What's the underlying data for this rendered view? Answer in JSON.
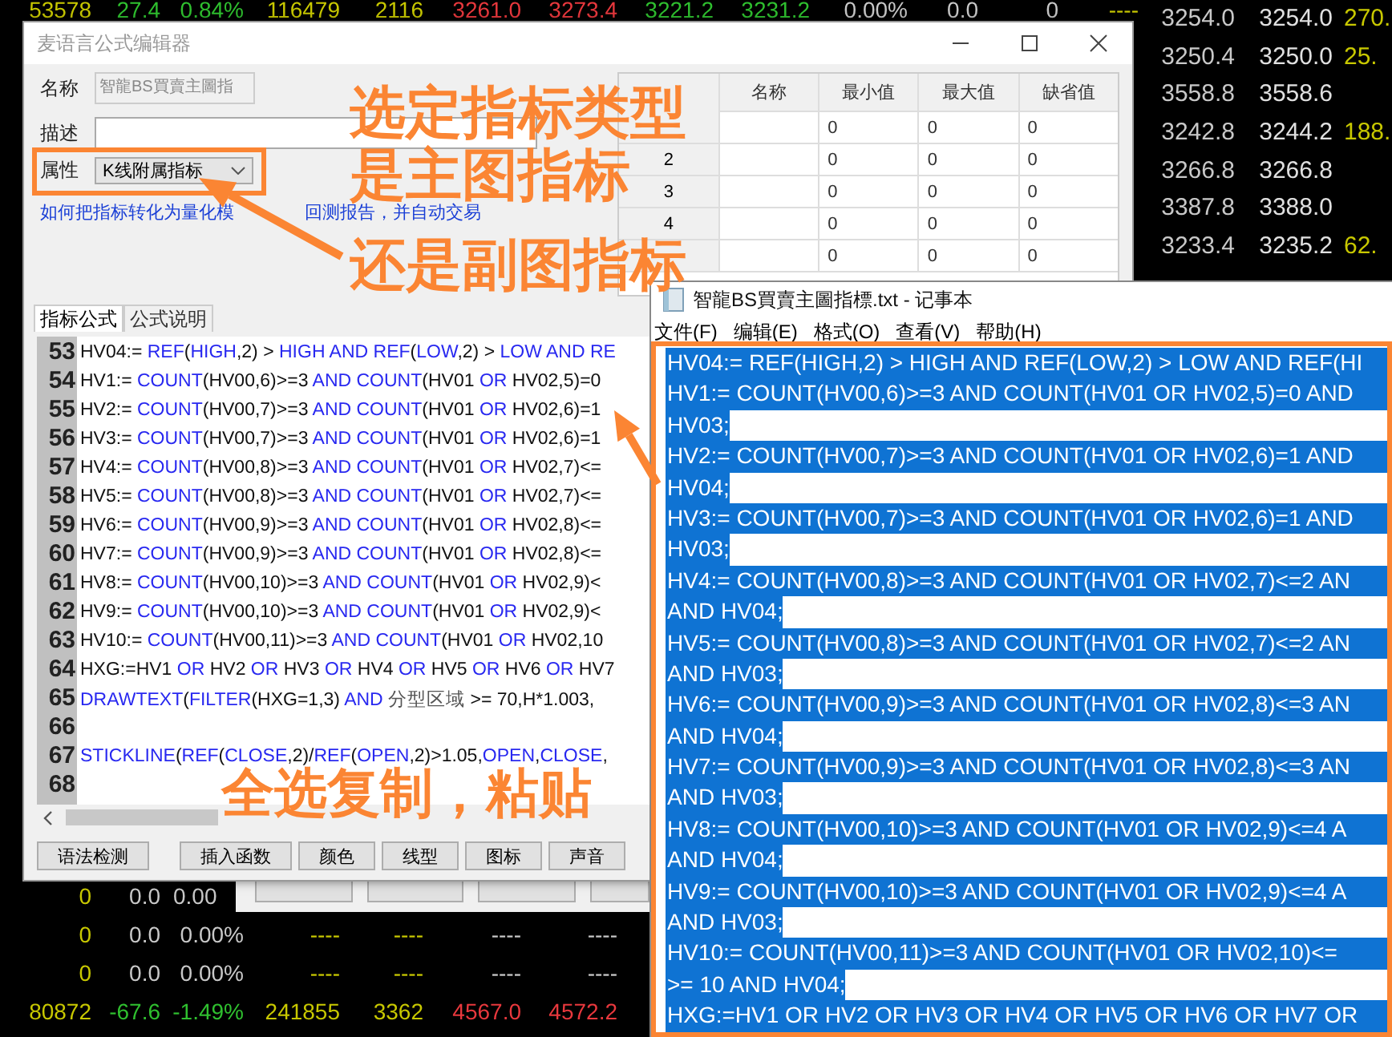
{
  "market": {
    "top_row": [
      {
        "text": "53578",
        "color": "#c8c800"
      },
      {
        "text": "27.4",
        "color": "#2fc02f"
      },
      {
        "text": "0.84%",
        "color": "#2fc02f"
      },
      {
        "text": "116479",
        "color": "#c8c800"
      },
      {
        "text": "2116",
        "color": "#c8c800"
      },
      {
        "text": "3261.0",
        "color": "#e8383d"
      },
      {
        "text": "3273.4",
        "color": "#e8383d"
      },
      {
        "text": "3221.2",
        "color": "#2fc02f"
      },
      {
        "text": "3231.2",
        "color": "#2fc02f"
      },
      {
        "text": "0.00%",
        "color": "#c8c8c8"
      },
      {
        "text": "0.0",
        "color": "#c8c8c8"
      },
      {
        "text": "0",
        "color": "#c8c8c8"
      },
      {
        "text": "----",
        "color": "#c8c800"
      }
    ],
    "right_rows": [
      [
        {
          "text": "3254.0",
          "color": "#c8c8c8"
        },
        {
          "text": "3254.0",
          "color": "#e0e0e0"
        },
        {
          "text": "270.",
          "color": "#c8c800"
        }
      ],
      [
        {
          "text": "3250.4",
          "color": "#c8c8c8"
        },
        {
          "text": "3250.0",
          "color": "#e0e0e0"
        },
        {
          "text": "25.",
          "color": "#c8c800"
        }
      ],
      [
        {
          "text": "3558.8",
          "color": "#c8c8c8"
        },
        {
          "text": "3558.6",
          "color": "#e0e0e0"
        }
      ],
      [
        {
          "text": "3242.8",
          "color": "#c8c8c8"
        },
        {
          "text": "3244.2",
          "color": "#e0e0e0"
        },
        {
          "text": "188.",
          "color": "#c8c800"
        }
      ],
      [
        {
          "text": "3266.8",
          "color": "#c8c8c8"
        },
        {
          "text": "3266.8",
          "color": "#e0e0e0"
        }
      ],
      [
        {
          "text": "3387.8",
          "color": "#c8c8c8"
        },
        {
          "text": "3388.0",
          "color": "#e0e0e0"
        }
      ],
      [
        {
          "text": "3233.4",
          "color": "#c8c8c8"
        },
        {
          "text": "3235.2",
          "color": "#e0e0e0"
        },
        {
          "text": "62.",
          "color": "#c8c800"
        }
      ]
    ],
    "bottom_rows": [
      [
        {
          "text": "0",
          "color": "#c8c800"
        },
        {
          "text": "0.0",
          "color": "#c8c8c8"
        },
        {
          "text": "0.00",
          "color": "#c8c8c8"
        }
      ],
      [
        {
          "text": "0",
          "color": "#c8c800"
        },
        {
          "text": "0.0",
          "color": "#c8c8c8"
        },
        {
          "text": "0.00%",
          "color": "#c8c8c8"
        },
        {
          "text": "----",
          "color": "#c8c800"
        },
        {
          "text": "----",
          "color": "#c8c800"
        },
        {
          "text": "----",
          "color": "#c8c8c8"
        },
        {
          "text": "----",
          "color": "#c8c8c8"
        }
      ],
      [
        {
          "text": "0",
          "color": "#c8c800"
        },
        {
          "text": "0.0",
          "color": "#c8c8c8"
        },
        {
          "text": "0.00%",
          "color": "#c8c8c8"
        },
        {
          "text": "----",
          "color": "#c8c800"
        },
        {
          "text": "----",
          "color": "#c8c800"
        },
        {
          "text": "----",
          "color": "#c8c8c8"
        },
        {
          "text": "----",
          "color": "#c8c8c8"
        }
      ],
      [
        {
          "text": "80872",
          "color": "#c8c800"
        },
        {
          "text": "-67.6",
          "color": "#2fc02f"
        },
        {
          "text": "-1.49%",
          "color": "#2fc02f"
        },
        {
          "text": "241855",
          "color": "#c8c800"
        },
        {
          "text": "3362",
          "color": "#c8c800"
        },
        {
          "text": "4567.0",
          "color": "#e8383d"
        },
        {
          "text": "4572.2",
          "color": "#e8383d"
        }
      ]
    ]
  },
  "editor": {
    "title": "麦语言公式编辑器",
    "name_field": {
      "label": "名称",
      "value": "智龍BS買賣主圖指",
      "disabled": true
    },
    "description_field": {
      "label": "描述"
    },
    "type_field": {
      "label": "属性",
      "value": "K线附属指标"
    },
    "help_link_parts": [
      "如何把指标转化为量化模",
      "回测报告，并自动交易"
    ],
    "params": {
      "columns": [
        "名称",
        "最小值",
        "最大值",
        "缺省值"
      ],
      "rows": [
        {
          "min": "0",
          "max": "0",
          "default": "0"
        },
        {
          "index": "2",
          "min": "0",
          "max": "0",
          "default": "0"
        },
        {
          "index": "3",
          "min": "0",
          "max": "0",
          "default": "0"
        },
        {
          "index": "4",
          "min": "0",
          "max": "0",
          "default": "0"
        },
        {
          "min": "0",
          "max": "0",
          "default": "0"
        }
      ]
    },
    "tabs": [
      {
        "label": "指标公式",
        "selected": true
      },
      {
        "label": "公式说明",
        "selected": false
      }
    ],
    "code_lines": [
      {
        "number": "53",
        "tokens": [
          {
            "kind": "plain",
            "text": "HV04:= "
          },
          {
            "kind": "keyword",
            "text": "REF"
          },
          {
            "kind": "plain",
            "text": "("
          },
          {
            "kind": "keyword",
            "text": "HIGH"
          },
          {
            "kind": "plain",
            "text": ",2) > "
          },
          {
            "kind": "keyword",
            "text": "HIGH AND REF"
          },
          {
            "kind": "plain",
            "text": "("
          },
          {
            "kind": "keyword",
            "text": "LOW"
          },
          {
            "kind": "plain",
            "text": ",2) > "
          },
          {
            "kind": "keyword",
            "text": "LOW AND RE"
          }
        ]
      },
      {
        "number": "54",
        "tokens": [
          {
            "kind": "plain",
            "text": "HV1:= "
          },
          {
            "kind": "keyword",
            "text": "COUNT"
          },
          {
            "kind": "plain",
            "text": "(HV00,6)>=3 "
          },
          {
            "kind": "keyword",
            "text": "AND COUNT"
          },
          {
            "kind": "plain",
            "text": "(HV01 "
          },
          {
            "kind": "keyword",
            "text": "OR"
          },
          {
            "kind": "plain",
            "text": " HV02,5)=0"
          }
        ]
      },
      {
        "number": "55",
        "tokens": [
          {
            "kind": "plain",
            "text": "HV2:= "
          },
          {
            "kind": "keyword",
            "text": "COUNT"
          },
          {
            "kind": "plain",
            "text": "(HV00,7)>=3 "
          },
          {
            "kind": "keyword",
            "text": "AND COUNT"
          },
          {
            "kind": "plain",
            "text": "(HV01 "
          },
          {
            "kind": "keyword",
            "text": "OR"
          },
          {
            "kind": "plain",
            "text": " HV02,6)=1"
          }
        ]
      },
      {
        "number": "56",
        "tokens": [
          {
            "kind": "plain",
            "text": "HV3:= "
          },
          {
            "kind": "keyword",
            "text": "COUNT"
          },
          {
            "kind": "plain",
            "text": "(HV00,7)>=3 "
          },
          {
            "kind": "keyword",
            "text": "AND COUNT"
          },
          {
            "kind": "plain",
            "text": "(HV01 "
          },
          {
            "kind": "keyword",
            "text": "OR"
          },
          {
            "kind": "plain",
            "text": " HV02,6)=1"
          }
        ]
      },
      {
        "number": "57",
        "tokens": [
          {
            "kind": "plain",
            "text": "HV4:= "
          },
          {
            "kind": "keyword",
            "text": "COUNT"
          },
          {
            "kind": "plain",
            "text": "(HV00,8)>=3 "
          },
          {
            "kind": "keyword",
            "text": "AND COUNT"
          },
          {
            "kind": "plain",
            "text": "(HV01 "
          },
          {
            "kind": "keyword",
            "text": "OR"
          },
          {
            "kind": "plain",
            "text": " HV02,7)<="
          }
        ]
      },
      {
        "number": "58",
        "tokens": [
          {
            "kind": "plain",
            "text": "HV5:= "
          },
          {
            "kind": "keyword",
            "text": "COUNT"
          },
          {
            "kind": "plain",
            "text": "(HV00,8)>=3 "
          },
          {
            "kind": "keyword",
            "text": "AND COUNT"
          },
          {
            "kind": "plain",
            "text": "(HV01 "
          },
          {
            "kind": "keyword",
            "text": "OR"
          },
          {
            "kind": "plain",
            "text": " HV02,7)<="
          }
        ]
      },
      {
        "number": "59",
        "tokens": [
          {
            "kind": "plain",
            "text": "HV6:= "
          },
          {
            "kind": "keyword",
            "text": "COUNT"
          },
          {
            "kind": "plain",
            "text": "(HV00,9)>=3 "
          },
          {
            "kind": "keyword",
            "text": "AND COUNT"
          },
          {
            "kind": "plain",
            "text": "(HV01 "
          },
          {
            "kind": "keyword",
            "text": "OR"
          },
          {
            "kind": "plain",
            "text": " HV02,8)<="
          }
        ]
      },
      {
        "number": "60",
        "tokens": [
          {
            "kind": "plain",
            "text": "HV7:= "
          },
          {
            "kind": "keyword",
            "text": "COUNT"
          },
          {
            "kind": "plain",
            "text": "(HV00,9)>=3 "
          },
          {
            "kind": "keyword",
            "text": "AND COUNT"
          },
          {
            "kind": "plain",
            "text": "(HV01 "
          },
          {
            "kind": "keyword",
            "text": "OR"
          },
          {
            "kind": "plain",
            "text": " HV02,8)<="
          }
        ]
      },
      {
        "number": "61",
        "tokens": [
          {
            "kind": "plain",
            "text": "HV8:= "
          },
          {
            "kind": "keyword",
            "text": "COUNT"
          },
          {
            "kind": "plain",
            "text": "(HV00,10)>=3 "
          },
          {
            "kind": "keyword",
            "text": "AND COUNT"
          },
          {
            "kind": "plain",
            "text": "(HV01 "
          },
          {
            "kind": "keyword",
            "text": "OR"
          },
          {
            "kind": "plain",
            "text": " HV02,9)<"
          }
        ]
      },
      {
        "number": "62",
        "tokens": [
          {
            "kind": "plain",
            "text": "HV9:= "
          },
          {
            "kind": "keyword",
            "text": "COUNT"
          },
          {
            "kind": "plain",
            "text": "(HV00,10)>=3 "
          },
          {
            "kind": "keyword",
            "text": "AND COUNT"
          },
          {
            "kind": "plain",
            "text": "(HV01 "
          },
          {
            "kind": "keyword",
            "text": "OR"
          },
          {
            "kind": "plain",
            "text": " HV02,9)<"
          }
        ]
      },
      {
        "number": "63",
        "tokens": [
          {
            "kind": "plain",
            "text": "HV10:= "
          },
          {
            "kind": "keyword",
            "text": "COUNT"
          },
          {
            "kind": "plain",
            "text": "(HV00,11)>=3 "
          },
          {
            "kind": "keyword",
            "text": "AND COUNT"
          },
          {
            "kind": "plain",
            "text": "(HV01 "
          },
          {
            "kind": "keyword",
            "text": "OR"
          },
          {
            "kind": "plain",
            "text": " HV02,10"
          }
        ]
      },
      {
        "number": "64",
        "tokens": [
          {
            "kind": "plain",
            "text": "HXG:=HV1 "
          },
          {
            "kind": "keyword",
            "text": "OR"
          },
          {
            "kind": "plain",
            "text": " HV2 "
          },
          {
            "kind": "keyword",
            "text": "OR"
          },
          {
            "kind": "plain",
            "text": " HV3 "
          },
          {
            "kind": "keyword",
            "text": "OR"
          },
          {
            "kind": "plain",
            "text": " HV4 "
          },
          {
            "kind": "keyword",
            "text": "OR"
          },
          {
            "kind": "plain",
            "text": " HV5 "
          },
          {
            "kind": "keyword",
            "text": "OR"
          },
          {
            "kind": "plain",
            "text": " HV6 "
          },
          {
            "kind": "keyword",
            "text": "OR"
          },
          {
            "kind": "plain",
            "text": " HV7"
          }
        ]
      },
      {
        "number": "65",
        "tokens": [
          {
            "kind": "keyword",
            "text": "DRAWTEXT"
          },
          {
            "kind": "plain",
            "text": "("
          },
          {
            "kind": "keyword",
            "text": "FILTER"
          },
          {
            "kind": "plain",
            "text": "(HXG=1,3) "
          },
          {
            "kind": "keyword",
            "text": "AND "
          },
          {
            "kind": "name",
            "text": "分型区域"
          },
          {
            "kind": "plain",
            "text": " >= 70,H*1.003,"
          }
        ]
      },
      {
        "number": "66"
      },
      {
        "number": "67",
        "tokens": [
          {
            "kind": "keyword",
            "text": "STICKLINE"
          },
          {
            "kind": "plain",
            "text": "("
          },
          {
            "kind": "keyword",
            "text": "REF"
          },
          {
            "kind": "plain",
            "text": "("
          },
          {
            "kind": "keyword",
            "text": "CLOSE"
          },
          {
            "kind": "plain",
            "text": ",2)/"
          },
          {
            "kind": "keyword",
            "text": "REF"
          },
          {
            "kind": "plain",
            "text": "("
          },
          {
            "kind": "keyword",
            "text": "OPEN"
          },
          {
            "kind": "plain",
            "text": ",2)>1.05,"
          },
          {
            "kind": "keyword",
            "text": "OPEN"
          },
          {
            "kind": "plain",
            "text": ","
          },
          {
            "kind": "keyword",
            "text": "CLOSE"
          },
          {
            "kind": "plain",
            "text": ","
          }
        ]
      },
      {
        "number": "68"
      }
    ],
    "buttons": [
      "语法检测",
      "插入函数",
      "颜色",
      "线型",
      "图标",
      "声音"
    ]
  },
  "notepad": {
    "title": "智龍BS買賣主圖指標.txt - 记事本",
    "menu": [
      "文件(F)",
      "编辑(E)",
      "格式(O)",
      "查看(V)",
      "帮助(H)"
    ],
    "selected": true,
    "lines": [
      {
        "text": "HV04:= REF(HIGH,2) > HIGH AND REF(LOW,2) > LOW AND REF(HI",
        "wraps": true
      },
      {
        "text": "HV1:= COUNT(HV00,6)>=3 AND COUNT(HV01 OR HV02,5)=0 AND",
        "wraps": true
      },
      {
        "text": "HV03;",
        "wraps": false
      },
      {
        "text": "HV2:= COUNT(HV00,7)>=3 AND COUNT(HV01 OR HV02,6)=1 AND",
        "wraps": true
      },
      {
        "text": "HV04;",
        "wraps": false
      },
      {
        "text": "HV3:= COUNT(HV00,7)>=3 AND COUNT(HV01 OR HV02,6)=1 AND",
        "wraps": true
      },
      {
        "text": "HV03;",
        "wraps": false
      },
      {
        "text": "HV4:= COUNT(HV00,8)>=3 AND COUNT(HV01 OR HV02,7)<=2 AN",
        "wraps": true
      },
      {
        "text": "AND HV04;",
        "wraps": false
      },
      {
        "text": "HV5:= COUNT(HV00,8)>=3 AND COUNT(HV01 OR HV02,7)<=2 AN",
        "wraps": true
      },
      {
        "text": "AND HV03;",
        "wraps": false
      },
      {
        "text": "HV6:= COUNT(HV00,9)>=3 AND COUNT(HV01 OR HV02,8)<=3 AN",
        "wraps": true
      },
      {
        "text": "AND HV04;",
        "wraps": false
      },
      {
        "text": "HV7:= COUNT(HV00,9)>=3 AND COUNT(HV01 OR HV02,8)<=3 AN",
        "wraps": true
      },
      {
        "text": "AND HV03;",
        "wraps": false
      },
      {
        "text": "HV8:= COUNT(HV00,10)>=3 AND COUNT(HV01 OR HV02,9)<=4 A",
        "wraps": true
      },
      {
        "text": "AND HV04;",
        "wraps": false
      },
      {
        "text": "HV9:= COUNT(HV00,10)>=3 AND COUNT(HV01 OR HV02,9)<=4 A",
        "wraps": true
      },
      {
        "text": "AND HV03;",
        "wraps": false
      },
      {
        "text": "HV10:= COUNT(HV00,11)>=3 AND COUNT(HV01 OR HV02,10)<=",
        "wraps": true
      },
      {
        "text": ">= 10 AND HV04;",
        "wraps": false
      },
      {
        "text": "HXG:=HV1 OR HV2 OR HV3 OR HV4 OR HV5 OR HV6 OR HV7 OR",
        "wraps": true
      }
    ]
  },
  "annotations": [
    {
      "kind": "caption",
      "text": "选定指标类型"
    },
    {
      "kind": "caption",
      "text": "是主图指标"
    },
    {
      "kind": "caption",
      "text": "还是副图指标"
    },
    {
      "kind": "caption",
      "text": "全选复制，粘贴"
    },
    {
      "kind": "box"
    },
    {
      "kind": "box"
    },
    {
      "kind": "arrow"
    },
    {
      "kind": "arrow"
    }
  ]
}
